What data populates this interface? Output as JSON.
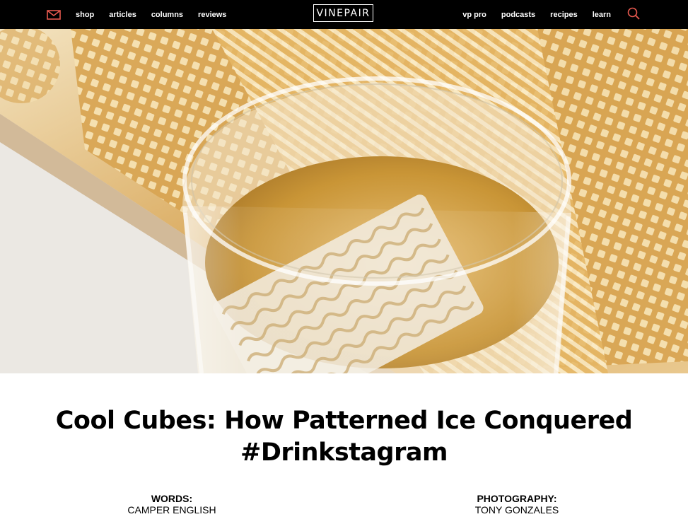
{
  "nav": {
    "left_items": [
      {
        "label": "shop"
      },
      {
        "label": "articles"
      },
      {
        "label": "columns"
      },
      {
        "label": "reviews"
      }
    ],
    "right_items": [
      {
        "label": "vp pro"
      },
      {
        "label": "podcasts"
      },
      {
        "label": "recipes"
      },
      {
        "label": "learn"
      }
    ],
    "logo_text": "VINEPAIR",
    "icons": {
      "mail": "mail-icon",
      "search": "search-icon"
    },
    "accent_color": "#e8594f"
  },
  "article": {
    "title": "Cool Cubes: How Patterned Ice Conquered #Drinkstagram",
    "credits": {
      "words_label": "WORDS:",
      "words_name": "CAMPER ENGLISH",
      "photo_label": "PHOTOGRAPHY:",
      "photo_name": "TONY GONZALES"
    }
  }
}
